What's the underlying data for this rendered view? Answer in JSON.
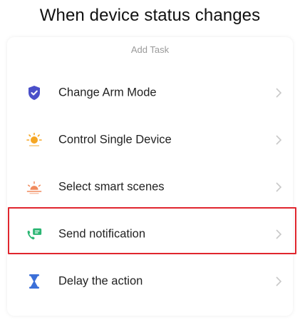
{
  "heading": "When device status changes",
  "card": {
    "title": "Add Task",
    "items": [
      {
        "label": "Change Arm Mode",
        "icon": "shield-icon",
        "color": "#4a4fc9"
      },
      {
        "label": "Control Single Device",
        "icon": "sun-icon",
        "color": "#f5a623"
      },
      {
        "label": "Select smart scenes",
        "icon": "sunrise-icon",
        "color": "#f08a5d"
      },
      {
        "label": "Send notification",
        "icon": "phone-message-icon",
        "color": "#2bb673"
      },
      {
        "label": "Delay the action",
        "icon": "hourglass-icon",
        "color": "#3b6fd8"
      }
    ]
  },
  "highlight": {
    "item": "Send notification",
    "color": "#e0262e"
  }
}
